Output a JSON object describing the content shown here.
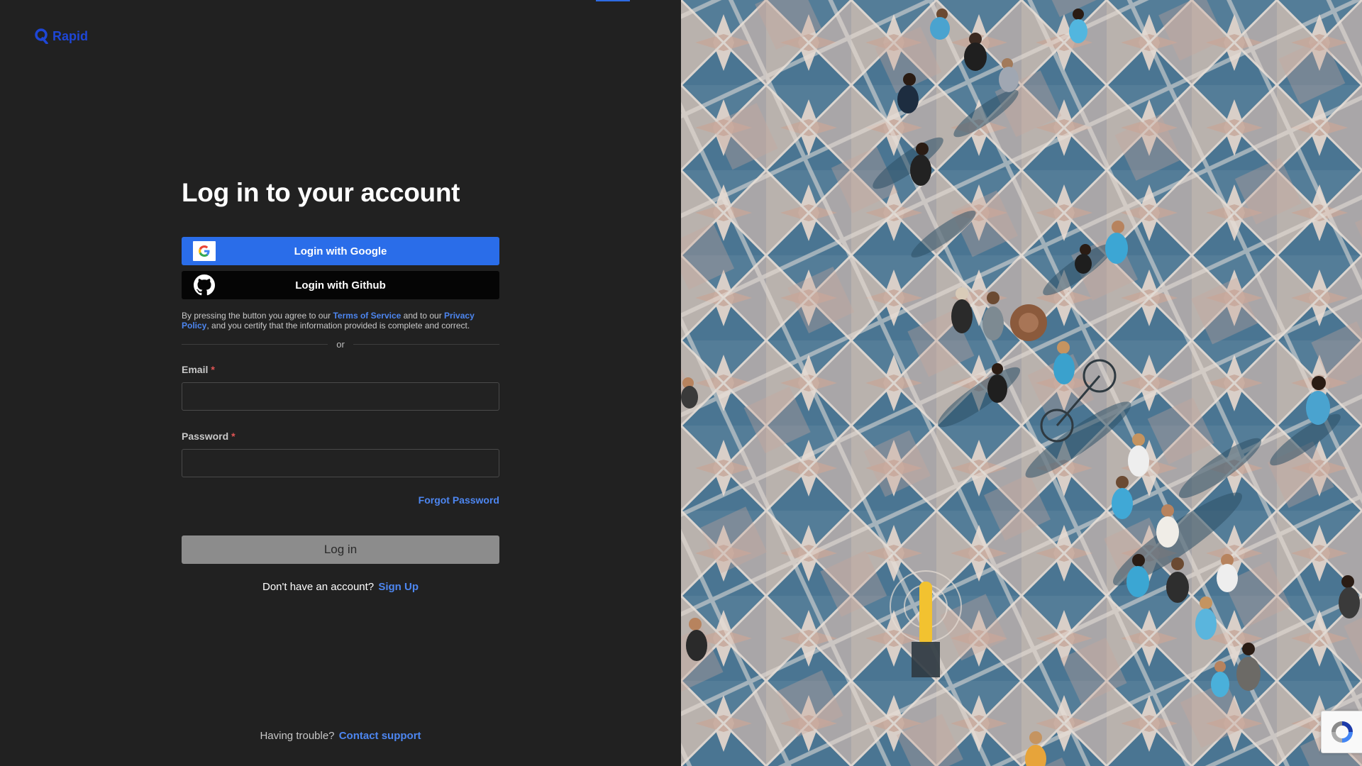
{
  "brand": {
    "name": "Rapid",
    "color": "#1e46d6"
  },
  "heading": {
    "title": "Log in to your account"
  },
  "sso": {
    "google_label": "Login with Google",
    "github_label": "Login with Github"
  },
  "legal": {
    "prefix": "By pressing the button you agree to our",
    "terms_link": "Terms of Service",
    "middle": "and to our",
    "privacy_link": "Privacy Policy",
    "suffix": ", and you certify that the information provided is complete and correct."
  },
  "divider": {
    "text": "or"
  },
  "form": {
    "email_label": "Email",
    "email_value": "",
    "password_label": "Password",
    "password_value": "",
    "required_mark": "*",
    "forgot_link": "Forgot Password",
    "submit_label": "Log in"
  },
  "signup": {
    "prompt": "Don't have an account?",
    "link": "Sign Up"
  },
  "support": {
    "prompt": "Having trouble?",
    "link": "Contact support"
  },
  "colors": {
    "accent": "#4d86f0",
    "google_button": "#2a6de9",
    "github_button": "#050505",
    "disabled_button": "#8c8c8c",
    "background": "#212121"
  },
  "icons": {
    "logo": "rapid-logo-icon",
    "google": "google-icon",
    "github": "github-icon",
    "captcha": "recaptcha-icon"
  }
}
